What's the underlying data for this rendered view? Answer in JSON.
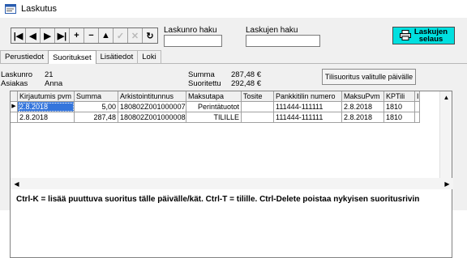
{
  "window": {
    "title": "Laskutus"
  },
  "toolbar": {
    "nav_buttons": [
      {
        "name": "first-record-button",
        "glyph": "|◀",
        "enabled": true
      },
      {
        "name": "prev-record-button",
        "glyph": "◀",
        "enabled": true
      },
      {
        "name": "next-record-button",
        "glyph": "▶",
        "enabled": true
      },
      {
        "name": "last-record-button",
        "glyph": "▶|",
        "enabled": true
      },
      {
        "name": "add-record-button",
        "glyph": "+",
        "enabled": true
      },
      {
        "name": "delete-record-button",
        "glyph": "−",
        "enabled": true
      },
      {
        "name": "edit-record-button",
        "glyph": "▲",
        "enabled": true
      },
      {
        "name": "post-record-button",
        "glyph": "✓",
        "enabled": false
      },
      {
        "name": "cancel-record-button",
        "glyph": "✕",
        "enabled": false
      },
      {
        "name": "refresh-button",
        "glyph": "↻",
        "enabled": true
      }
    ],
    "invoice_search_label": "Laskunro haku",
    "invoice_search_value": "",
    "invoices_search_label": "Laskujen haku",
    "invoices_search_value": "",
    "browse_label_line1": "Laskujen",
    "browse_label_line2": "selaus"
  },
  "tabs": [
    {
      "label": "Perustiedot",
      "active": false
    },
    {
      "label": "Suoritukset",
      "active": true
    },
    {
      "label": "Lisätiedot",
      "active": false
    },
    {
      "label": "Loki",
      "active": false
    }
  ],
  "info": {
    "invoice_no_label": "Laskunro",
    "invoice_no_value": "21",
    "customer_label": "Asiakas",
    "customer_value": "Anna",
    "sum_label": "Summa",
    "sum_value": "287,48 €",
    "paid_label": "Suoritettu",
    "paid_value": "292,48 €",
    "pay_button_label": "Tilisuoritus valitulle päivälle"
  },
  "grid": {
    "columns": [
      "Kirjautumis pvm",
      "Summa",
      "Arkistointitunnus",
      "Maksutapa",
      "Tosite",
      "Pankkitilin numero",
      "MaksuPvm",
      "KPTili",
      "I"
    ],
    "rows": [
      [
        "2.8.2018",
        "5,00",
        "180802Z001000007",
        "Perintätuotot",
        "",
        "111444-111111",
        "2.8.2018",
        "1810",
        ""
      ],
      [
        "2.8.2018",
        "287,48",
        "180802Z001000008",
        "TILILLE",
        "",
        "111444-111111",
        "2.8.2018",
        "1810",
        ""
      ]
    ]
  },
  "footer_text": "Ctrl-K = lisää puuttuva suoritus tälle päivälle/kät. Ctrl-T = tilille. Ctrl-Delete poistaa nykyisen suoritusrivin",
  "colors": {
    "browse_button": "#00e0e0",
    "selection": "#3475dc"
  }
}
